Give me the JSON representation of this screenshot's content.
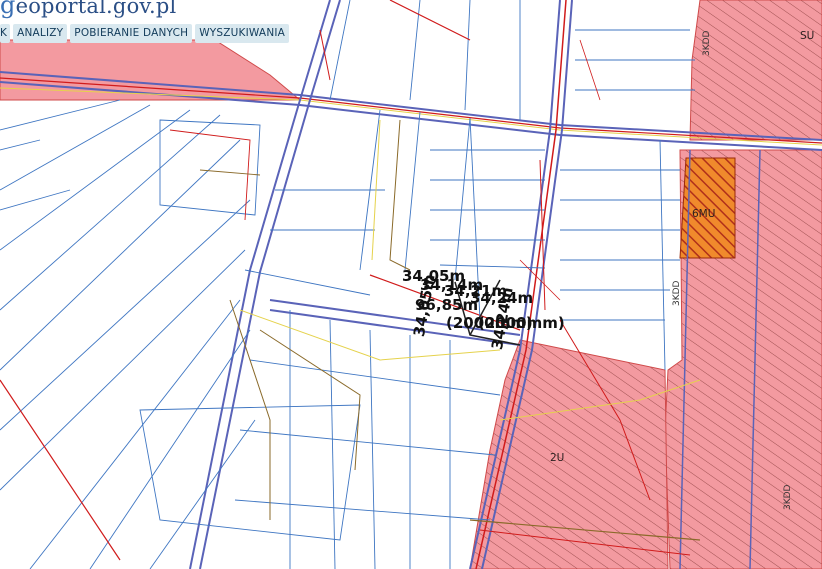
{
  "header": {
    "logo_prefix": "g",
    "logo_text": "eoportal.gov.pl"
  },
  "menu": {
    "items": [
      {
        "label": "K"
      },
      {
        "label": "ANALIZY"
      },
      {
        "label": "POBIERANIE DANYCH"
      },
      {
        "label": "WYSZUKIWANIA"
      }
    ]
  },
  "map": {
    "zone_labels": {
      "zone_6mu": "6MU",
      "zone_2u": "2U",
      "zone_su": "SU"
    },
    "road_labels": {
      "road_top": "3KDD",
      "road_mid": "3KDD",
      "road_lower": "3KDD"
    },
    "measurements": {
      "m1": "34,05m",
      "m2": "34,14m",
      "m3": "34,21m",
      "m4": "34,24m",
      "m5": "96,85m",
      "m6": "(2000mm)",
      "m7": "(2000mm)"
    },
    "colors": {
      "zone_fill": "#f39aa0",
      "zone_hatch": "#8a3b3b",
      "mixed_zone_fill": "#e8701e",
      "parcel_line": "#3f76c2",
      "road_edge": "#5a63b8",
      "utility_red": "#d01b1b",
      "utility_brown": "#8a6a2a",
      "utility_yellow": "#e5d24c"
    }
  }
}
